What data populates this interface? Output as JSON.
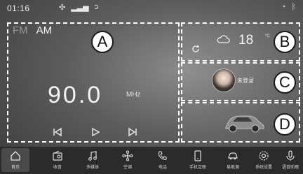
{
  "statusbar": {
    "time": "01:16",
    "icons": [
      "fan-icon",
      "signal-icon",
      "usb-icon"
    ],
    "right_icons": [
      "wifi-icon",
      "bluetooth-icon"
    ]
  },
  "radio": {
    "bands": [
      "FM",
      "AM"
    ],
    "selected_band": "AM",
    "frequency": "90.0",
    "unit": "MHz",
    "controls": [
      "previous-icon",
      "play-icon",
      "next-icon"
    ]
  },
  "weather": {
    "temperature": "18",
    "unit_note": "°C"
  },
  "user": {
    "status": "未登录"
  },
  "markers": {
    "a": "A",
    "b": "B",
    "c": "C",
    "d": "D"
  },
  "dock": {
    "items": [
      {
        "label": "首页",
        "icon": "home-icon"
      },
      {
        "label": "收音",
        "icon": "radio-icon"
      },
      {
        "label": "多媒体",
        "icon": "music-icon"
      },
      {
        "label": "空调",
        "icon": "fan-icon"
      },
      {
        "label": "电话",
        "icon": "phone-icon"
      },
      {
        "label": "手机互联",
        "icon": "phone-link-icon"
      },
      {
        "label": "易能源",
        "icon": "car-icon"
      },
      {
        "label": "系统设置",
        "icon": "settings-icon"
      },
      {
        "label": "语音助理",
        "icon": "microphone-icon"
      }
    ]
  },
  "colors": {
    "background": "#5c5c5c",
    "dock": "#2b2b2b",
    "text": "#f3f3f3",
    "dashed_border": "#ffffff"
  }
}
